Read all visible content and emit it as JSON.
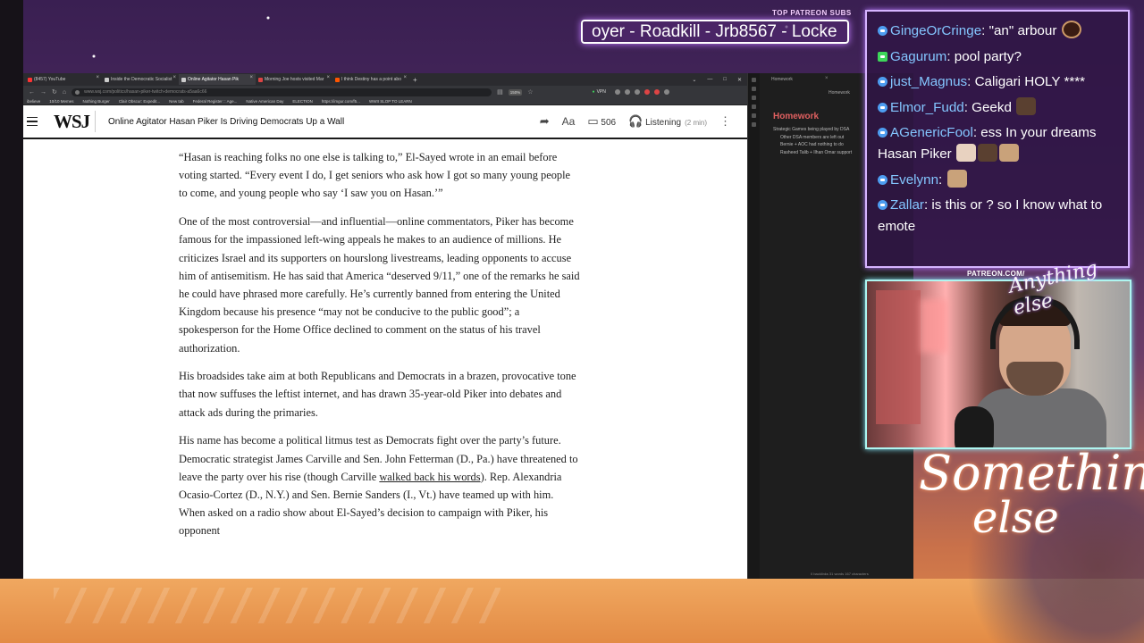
{
  "overlay": {
    "patreon_label": "TOP PATREON SUBS",
    "ticker_text": "oyer - Roadkill - Jrb8567 - Locke",
    "patreon_url": "PATREON.COM/",
    "anything_else": "Anything else",
    "something_else_line1": "Something",
    "something_else_line2": "else"
  },
  "browser": {
    "tabs": [
      {
        "label": "(8457) YouTube",
        "color": "#ff3333",
        "active": false
      },
      {
        "label": "Inside the Democratic Socialist",
        "color": "#cccccc",
        "active": false
      },
      {
        "label": "Online Agitator Hasan Pik",
        "color": "#cccccc",
        "active": true
      },
      {
        "label": "Morning Joe hosts visited Mar",
        "color": "#d44",
        "active": false
      },
      {
        "label": "I think Destiny has a point abo",
        "color": "#ff5500",
        "active": false
      }
    ],
    "url": "www.wsj.com/politics/hasan-piker-twitch-democrats-a5aa6c66",
    "zoom": "150%",
    "vpn": "VPN",
    "bookmarks": [
      "ibelieve",
      "10/10 Memes",
      "Nothing Burger",
      "Clair Obscur: Expedit...",
      "New tab",
      "Federal Register :: Age...",
      "Native American Day",
      "ELECTION",
      "https://imgur.com/f5...",
      "WWII SLOP TO LEARN"
    ]
  },
  "wsj": {
    "logo": "WSJ",
    "headline": "Online Agitator Hasan Piker Is Driving Democrats Up a Wall",
    "comment_count": "506",
    "listening": "Listening",
    "listening_duration": "(2 min)"
  },
  "article": {
    "p1": "“Hasan is reaching folks no one else is talking to,” El-Sayed wrote in an email before voting started. “Every event I do, I get seniors who ask how I got so many young people to come, and young people who say ‘I saw you on Hasan.’”",
    "p2": "One of the most controversial—and influential—online commentators, Piker has become famous for the impassioned left-wing appeals he makes to an audience of millions. He criticizes Israel and its supporters on hourslong livestreams, leading opponents to accuse him of antisemitism. He has said that America “deserved 9/11,” one of the remarks he said he could have phrased more carefully. He’s currently banned from entering the United Kingdom because his presence “may not be conducive to the public good”; a spokesperson for the Home Office declined to comment on the status of his travel authorization.",
    "p3": "His broadsides take aim at both Republicans and Democrats in a brazen, provocative tone that now suffuses the leftist internet, and has drawn 35-year-old Piker into debates and attack ads during the primaries.",
    "p4_a": "His name has become a political litmus test as Democrats fight over the party’s future. Democratic strategist James Carville and Sen. John Fetterman (D., Pa.) have threatened to leave the party over his rise (though Carville ",
    "p4_link": "walked back his words",
    "p4_b": "). Rep. Alexandria Ocasio-Cortez (D., N.Y.) and Sen. Bernie Sanders (I., Vt.) have teamed up with him. When asked on a radio show about El-Sayed’s decision to campaign with Piker, his opponent"
  },
  "obsidian": {
    "tab": "Homework",
    "tab2": "Homework",
    "title": "Homework",
    "lines": [
      "Strategic Games being played by DSA",
      "Other DSA members are left out",
      "Bernie + AOC had nothing to do",
      "Rasheed Talib + Ilhan Omar support"
    ],
    "status": "0 backlinks   31 words   167 characters"
  },
  "chat": [
    {
      "user": "GingeOrCringe",
      "text": ": \"an\" arbour",
      "badge": "blue",
      "emotes": [
        "round"
      ]
    },
    {
      "user": "Gagurum",
      "text": ": pool party?",
      "badge": "green",
      "emotes": []
    },
    {
      "user": "just_Magnus",
      "text": ": Caligari  HOLY ****",
      "badge": "blue",
      "emotes": []
    },
    {
      "user": "Elmor_Fudd",
      "text": ": Geekd",
      "badge": "blue",
      "emotes": [
        "dark"
      ]
    },
    {
      "user": "AGenericFool",
      "text": ": ess In your dreams Hasan Piker",
      "badge": "blue",
      "emotes": [
        "pale",
        "dark",
        "tan"
      ]
    },
    {
      "user": "Evelynn",
      "text": ":",
      "badge": "blue",
      "emotes": [
        "tan"
      ]
    },
    {
      "user": "Zallar",
      "text": ": is this  or  ? so I know what to emote",
      "badge": "blue",
      "emotes": []
    }
  ]
}
